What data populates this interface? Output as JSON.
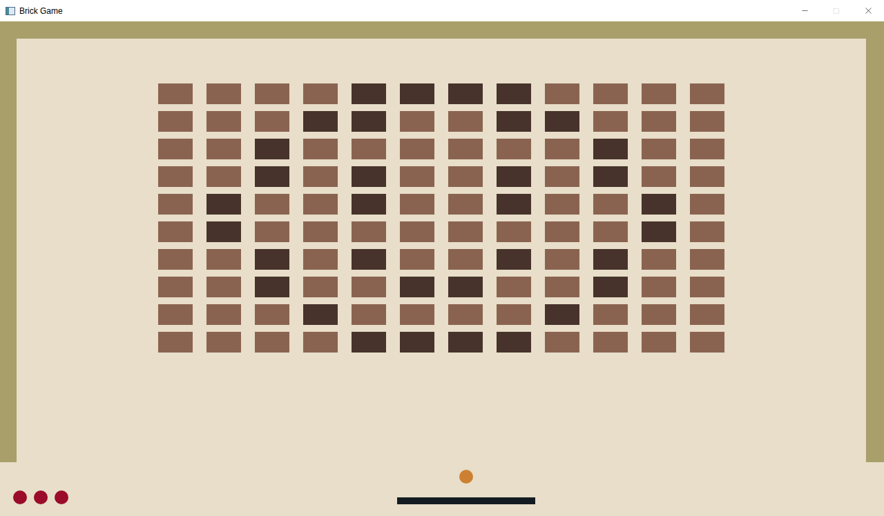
{
  "window": {
    "title": "Brick Game"
  },
  "lives": 3,
  "brick_rows": [
    {
      "bricks": [
        "#8a6350",
        "#8a6350",
        "#8a6350",
        "#8a6350",
        "#47332b",
        "#47332b",
        "#47332b",
        "#47332b",
        "#8a6350",
        "#8a6350",
        "#8a6350",
        "#8a6350"
      ]
    },
    {
      "bricks": [
        "#8a6350",
        "#8a6350",
        "#8a6350",
        "#47332b",
        "#47332b",
        "#8a6350",
        "#8a6350",
        "#47332b",
        "#47332b",
        "#8a6350",
        "#8a6350",
        "#8a6350"
      ]
    },
    {
      "bricks": [
        "#8a6350",
        "#8a6350",
        "#47332b",
        "#8a6350",
        "#8a6350",
        "#8a6350",
        "#8a6350",
        "#8a6350",
        "#8a6350",
        "#47332b",
        "#8a6350",
        "#8a6350"
      ]
    },
    {
      "bricks": [
        "#8a6350",
        "#8a6350",
        "#47332b",
        "#8a6350",
        "#47332b",
        "#8a6350",
        "#8a6350",
        "#47332b",
        "#8a6350",
        "#47332b",
        "#8a6350",
        "#8a6350"
      ]
    },
    {
      "bricks": [
        "#8a6350",
        "#47332b",
        "#8a6350",
        "#8a6350",
        "#47332b",
        "#8a6350",
        "#8a6350",
        "#47332b",
        "#8a6350",
        "#8a6350",
        "#47332b",
        "#8a6350"
      ]
    },
    {
      "bricks": [
        "#8a6350",
        "#47332b",
        "#8a6350",
        "#8a6350",
        "#8a6350",
        "#8a6350",
        "#8a6350",
        "#8a6350",
        "#8a6350",
        "#8a6350",
        "#47332b",
        "#8a6350"
      ]
    },
    {
      "bricks": [
        "#8a6350",
        "#8a6350",
        "#47332b",
        "#8a6350",
        "#47332b",
        "#8a6350",
        "#8a6350",
        "#47332b",
        "#8a6350",
        "#47332b",
        "#8a6350",
        "#8a6350"
      ]
    },
    {
      "bricks": [
        "#8a6350",
        "#8a6350",
        "#47332b",
        "#8a6350",
        "#8a6350",
        "#47332b",
        "#47332b",
        "#8a6350",
        "#8a6350",
        "#47332b",
        "#8a6350",
        "#8a6350"
      ]
    },
    {
      "bricks": [
        "#8a6350",
        "#8a6350",
        "#8a6350",
        "#47332b",
        "#8a6350",
        "#8a6350",
        "#8a6350",
        "#8a6350",
        "#47332b",
        "#8a6350",
        "#8a6350",
        "#8a6350"
      ]
    },
    {
      "bricks": [
        "#8a6350",
        "#8a6350",
        "#8a6350",
        "#8a6350",
        "#47332b",
        "#47332b",
        "#47332b",
        "#47332b",
        "#8a6350",
        "#8a6350",
        "#8a6350",
        "#8a6350"
      ]
    }
  ]
}
